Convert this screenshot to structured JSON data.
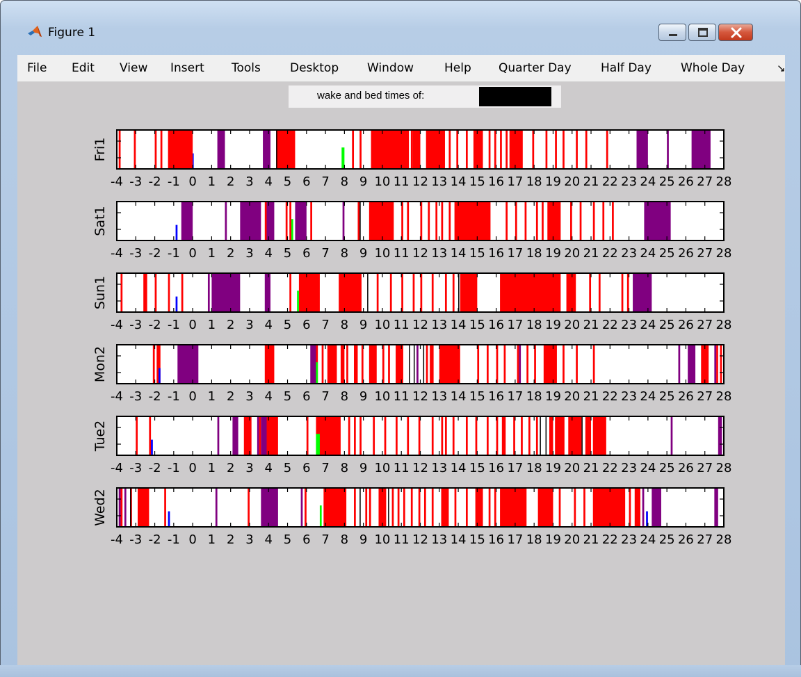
{
  "window": {
    "title": "Figure 1",
    "icon": "matlab-icon",
    "controls": [
      "minimize-icon",
      "maximize-icon",
      "close-icon"
    ]
  },
  "menu": [
    {
      "label": "File"
    },
    {
      "label": "Edit"
    },
    {
      "label": "View"
    },
    {
      "label": "Insert"
    },
    {
      "label": "Tools"
    },
    {
      "label": "Desktop"
    },
    {
      "label": "Window"
    },
    {
      "label": "Help"
    },
    {
      "label": "Quarter Day"
    },
    {
      "label": "Half Day"
    },
    {
      "label": "Whole Day"
    }
  ],
  "menu_overflow": "↘",
  "header": {
    "label": "wake and bed times of:",
    "redacted": true
  },
  "colors": {
    "red": "#ff0000",
    "purple": "#800080",
    "green": "#00ff00",
    "blue": "#0000ff",
    "black": "#000000",
    "figure_bg": "#cdcbcc",
    "axes_bg": "#ffffff"
  },
  "chart_data": {
    "type": "heatmap",
    "xlim": [
      -4,
      28
    ],
    "xticks": [
      -4,
      -3,
      -2,
      -1,
      0,
      1,
      2,
      3,
      4,
      5,
      6,
      7,
      8,
      9,
      10,
      11,
      12,
      13,
      14,
      15,
      16,
      17,
      18,
      19,
      20,
      21,
      22,
      23,
      24,
      25,
      26,
      27,
      28
    ],
    "xtick_labels": [
      "-4",
      "-3",
      "-2",
      "-1",
      "0",
      "1",
      "2",
      "3",
      "4",
      "5",
      "6",
      "7",
      "8",
      "9",
      "10",
      "11",
      "12",
      "13",
      "14",
      "15",
      "16",
      "17",
      "18",
      "19",
      "20",
      "21",
      "22",
      "23",
      "24",
      "25",
      "26",
      "27",
      "28"
    ],
    "grid": false,
    "rows": [
      {
        "label": "Fri1",
        "red": [
          [
            -3.9,
            -3.8
          ],
          [
            -3.1,
            -3.0
          ],
          [
            -2.0,
            -1.9
          ],
          [
            -1.7,
            -1.6
          ],
          [
            -1.3,
            0.0
          ],
          [
            3.8,
            3.9
          ],
          [
            4.4,
            5.4
          ],
          [
            8.4,
            8.5
          ],
          [
            8.8,
            8.9
          ],
          [
            9.4,
            11.4
          ],
          [
            11.5,
            11.6
          ],
          [
            11.6,
            12.0
          ],
          [
            12.3,
            13.3
          ],
          [
            13.5,
            13.6
          ],
          [
            13.9,
            14.0
          ],
          [
            14.4,
            14.5
          ],
          [
            14.8,
            15.3
          ],
          [
            15.6,
            15.7
          ],
          [
            15.9,
            16.0
          ],
          [
            16.2,
            16.3
          ],
          [
            16.5,
            16.6
          ],
          [
            16.7,
            17.4
          ],
          [
            17.9,
            18.0
          ],
          [
            18.6,
            18.7
          ],
          [
            19.1,
            19.2
          ],
          [
            19.5,
            19.6
          ],
          [
            20.2,
            20.3
          ],
          [
            20.7,
            20.8
          ],
          [
            21.8,
            21.9
          ]
        ],
        "purple": [
          [
            1.3,
            1.7
          ],
          [
            3.7,
            4.1
          ],
          [
            23.4,
            24.0
          ],
          [
            25.0,
            25.1
          ],
          [
            26.3,
            27.3
          ]
        ],
        "green": [
          [
            7.85,
            8.0
          ]
        ],
        "blue": [
          [
            0.0,
            0.05
          ]
        ],
        "black": [
          [
            4.4,
            4.45
          ]
        ]
      },
      {
        "label": "Sat1",
        "red": [
          [
            3.8,
            3.9
          ],
          [
            4.9,
            5.0
          ],
          [
            5.1,
            5.2
          ],
          [
            6.2,
            6.3
          ],
          [
            8.7,
            8.8
          ],
          [
            9.3,
            10.6
          ],
          [
            11.0,
            11.1
          ],
          [
            11.3,
            11.4
          ],
          [
            12.0,
            12.1
          ],
          [
            12.4,
            12.5
          ],
          [
            12.8,
            12.9
          ],
          [
            13.1,
            13.2
          ],
          [
            13.5,
            13.6
          ],
          [
            13.8,
            15.7
          ],
          [
            16.5,
            16.6
          ],
          [
            17.0,
            17.1
          ],
          [
            17.5,
            17.6
          ],
          [
            18.1,
            18.2
          ],
          [
            18.4,
            18.5
          ],
          [
            18.7,
            19.4
          ],
          [
            19.9,
            20.0
          ],
          [
            20.4,
            20.5
          ],
          [
            21.1,
            21.2
          ],
          [
            21.6,
            21.7
          ],
          [
            22.1,
            22.2
          ]
        ],
        "purple": [
          [
            -0.6,
            0.0
          ],
          [
            1.7,
            1.8
          ],
          [
            2.5,
            3.6
          ],
          [
            3.9,
            4.3
          ],
          [
            5.4,
            6.0
          ],
          [
            7.9,
            8.0
          ],
          [
            23.8,
            25.2
          ]
        ],
        "green": [
          [
            5.2,
            5.3
          ]
        ],
        "blue": [
          [
            -0.9,
            -0.8
          ]
        ],
        "black": [
          [
            8.8,
            8.85
          ]
        ]
      },
      {
        "label": "Sun1",
        "red": [
          [
            -3.8,
            -3.7
          ],
          [
            -2.6,
            -2.4
          ],
          [
            -2.0,
            -1.9
          ],
          [
            -1.3,
            -1.2
          ],
          [
            -0.6,
            -0.5
          ],
          [
            1.1,
            1.2
          ],
          [
            5.1,
            5.2
          ],
          [
            5.6,
            6.7
          ],
          [
            7.7,
            8.9
          ],
          [
            9.7,
            9.8
          ],
          [
            10.4,
            10.5
          ],
          [
            11.0,
            11.1
          ],
          [
            11.6,
            11.7
          ],
          [
            12.0,
            12.1
          ],
          [
            12.6,
            12.7
          ],
          [
            13.3,
            13.4
          ],
          [
            13.7,
            13.8
          ],
          [
            14.1,
            15.0
          ],
          [
            16.2,
            19.4
          ],
          [
            19.7,
            20.2
          ],
          [
            20.9,
            21.0
          ],
          [
            21.4,
            21.5
          ],
          [
            22.6,
            22.7
          ],
          [
            22.9,
            23.0
          ]
        ],
        "purple": [
          [
            0.8,
            0.9
          ],
          [
            1.0,
            2.5
          ],
          [
            3.8,
            4.1
          ],
          [
            23.2,
            24.2
          ]
        ],
        "green": [
          [
            5.5,
            5.6
          ]
        ],
        "blue": [
          [
            -0.9,
            -0.8
          ]
        ],
        "black": [
          [
            9.2,
            9.25
          ],
          [
            14.0,
            14.05
          ]
        ]
      },
      {
        "label": "Mon2",
        "red": [
          [
            -2.1,
            -2.0
          ],
          [
            -1.9,
            -1.7
          ],
          [
            3.8,
            4.3
          ],
          [
            6.4,
            6.6
          ],
          [
            6.8,
            6.9
          ],
          [
            7.1,
            7.6
          ],
          [
            7.8,
            8.0
          ],
          [
            8.1,
            8.2
          ],
          [
            8.5,
            8.7
          ],
          [
            8.9,
            9.0
          ],
          [
            9.3,
            9.7
          ],
          [
            10.0,
            10.1
          ],
          [
            10.3,
            10.4
          ],
          [
            10.7,
            11.1
          ],
          [
            12.3,
            12.4
          ],
          [
            12.5,
            12.7
          ],
          [
            13.0,
            14.1
          ],
          [
            15.0,
            15.1
          ],
          [
            15.5,
            15.6
          ],
          [
            16.0,
            16.1
          ],
          [
            16.4,
            16.5
          ],
          [
            17.1,
            17.2
          ],
          [
            17.6,
            17.7
          ],
          [
            18.0,
            18.1
          ],
          [
            18.5,
            19.2
          ],
          [
            19.5,
            19.6
          ],
          [
            20.2,
            20.3
          ],
          [
            21.1,
            21.2
          ],
          [
            26.8,
            27.2
          ],
          [
            27.6,
            27.7
          ],
          [
            27.8,
            27.9
          ]
        ],
        "purple": [
          [
            -0.8,
            0.3
          ],
          [
            6.2,
            6.5
          ],
          [
            11.8,
            11.9
          ],
          [
            17.2,
            17.3
          ],
          [
            25.6,
            25.7
          ],
          [
            26.1,
            26.5
          ],
          [
            27.5,
            27.6
          ]
        ],
        "green": [
          [
            6.5,
            6.6
          ]
        ],
        "blue": [
          [
            -1.8,
            -1.7
          ]
        ],
        "black": [
          [
            11.4,
            11.45
          ],
          [
            11.65,
            11.7
          ],
          [
            12.15,
            12.2
          ]
        ]
      },
      {
        "label": "Tue2",
        "red": [
          [
            -3.0,
            -2.9
          ],
          [
            -2.3,
            -2.2
          ],
          [
            2.7,
            3.1
          ],
          [
            3.5,
            3.6
          ],
          [
            3.8,
            4.5
          ],
          [
            6.0,
            6.1
          ],
          [
            6.5,
            7.8
          ],
          [
            8.2,
            8.3
          ],
          [
            8.5,
            8.6
          ],
          [
            8.8,
            8.9
          ],
          [
            9.5,
            9.6
          ],
          [
            10.1,
            10.2
          ],
          [
            10.7,
            10.8
          ],
          [
            11.3,
            11.4
          ],
          [
            11.9,
            12.0
          ],
          [
            12.6,
            12.7
          ],
          [
            13.1,
            13.2
          ],
          [
            13.3,
            13.4
          ],
          [
            13.7,
            13.8
          ],
          [
            14.4,
            14.5
          ],
          [
            14.9,
            15.0
          ],
          [
            15.5,
            15.6
          ],
          [
            16.0,
            16.1
          ],
          [
            16.3,
            16.5
          ],
          [
            16.9,
            17.0
          ],
          [
            17.3,
            17.4
          ],
          [
            17.7,
            17.8
          ],
          [
            18.1,
            18.2
          ],
          [
            18.8,
            19.0
          ],
          [
            19.1,
            19.6
          ],
          [
            19.8,
            20.5
          ],
          [
            20.7,
            21.0
          ],
          [
            21.1,
            21.8
          ]
        ],
        "purple": [
          [
            1.3,
            1.4
          ],
          [
            2.1,
            2.4
          ],
          [
            3.4,
            3.5
          ],
          [
            3.6,
            3.9
          ],
          [
            25.2,
            25.3
          ],
          [
            27.7,
            27.9
          ]
        ],
        "green": [
          [
            6.5,
            6.7
          ]
        ],
        "blue": [
          [
            -2.2,
            -2.1
          ]
        ],
        "black": [
          [
            18.3,
            18.35
          ],
          [
            18.6,
            18.65
          ],
          [
            20.5,
            20.55
          ]
        ]
      },
      {
        "label": "Wed2",
        "red": [
          [
            -3.8,
            -3.7
          ],
          [
            -3.3,
            -3.2
          ],
          [
            -2.9,
            -2.3
          ],
          [
            -1.5,
            -1.4
          ],
          [
            2.9,
            3.0
          ],
          [
            5.9,
            6.0
          ],
          [
            6.9,
            8.1
          ],
          [
            8.5,
            8.6
          ],
          [
            9.1,
            9.2
          ],
          [
            9.3,
            9.4
          ],
          [
            9.8,
            10.2
          ],
          [
            10.5,
            10.6
          ],
          [
            10.8,
            10.9
          ],
          [
            11.1,
            11.2
          ],
          [
            11.5,
            11.6
          ],
          [
            11.9,
            12.0
          ],
          [
            12.2,
            12.3
          ],
          [
            12.6,
            12.7
          ],
          [
            13.1,
            13.5
          ],
          [
            13.8,
            13.9
          ],
          [
            14.4,
            14.5
          ],
          [
            14.9,
            15.3
          ],
          [
            15.6,
            15.7
          ],
          [
            15.9,
            16.0
          ],
          [
            16.2,
            17.6
          ],
          [
            18.2,
            19.0
          ],
          [
            19.3,
            19.4
          ],
          [
            20.1,
            20.2
          ],
          [
            20.6,
            20.7
          ],
          [
            21.1,
            22.8
          ],
          [
            23.0,
            23.1
          ],
          [
            23.3,
            23.6
          ]
        ],
        "purple": [
          [
            -3.9,
            -3.8
          ],
          [
            -3.6,
            -3.5
          ],
          [
            1.2,
            1.3
          ],
          [
            3.6,
            4.5
          ],
          [
            5.7,
            5.8
          ],
          [
            23.7,
            23.8
          ],
          [
            24.2,
            24.7
          ],
          [
            27.5,
            27.7
          ]
        ],
        "green": [
          [
            6.7,
            6.8
          ]
        ],
        "blue": [
          [
            -1.3,
            -1.2
          ],
          [
            23.9,
            24.0
          ]
        ],
        "black": [
          [
            -3.3,
            -3.25
          ],
          [
            8.8,
            8.85
          ],
          [
            10.3,
            10.35
          ]
        ]
      }
    ]
  }
}
